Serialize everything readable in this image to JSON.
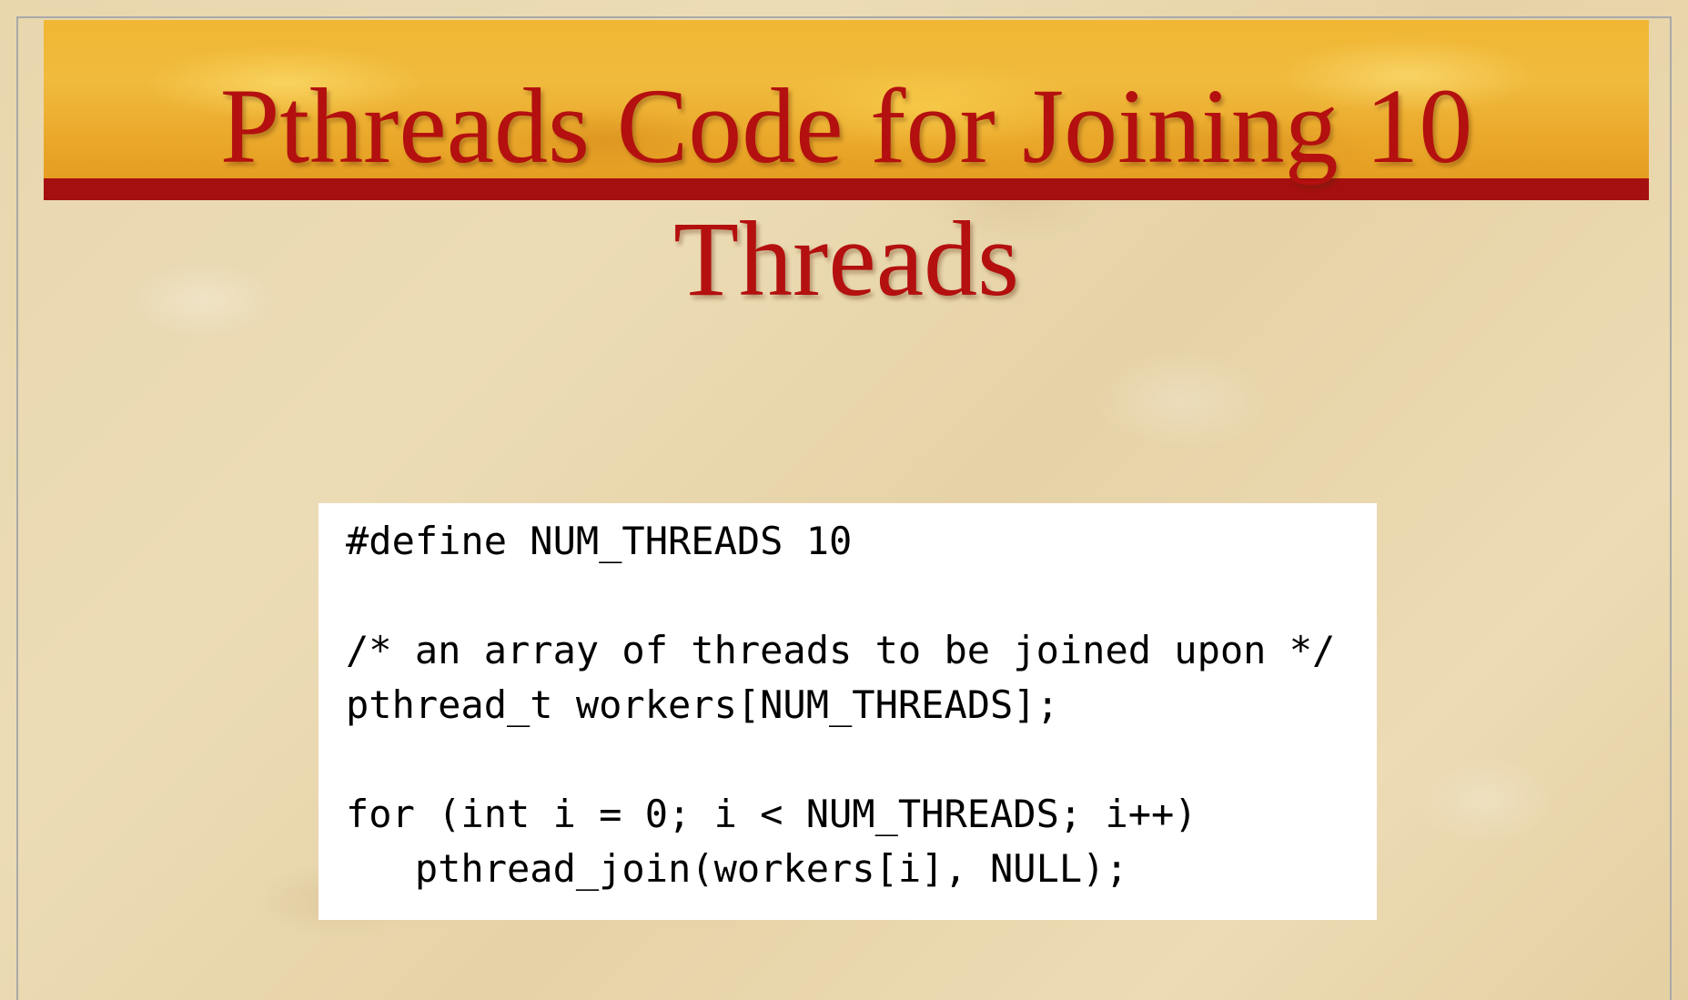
{
  "slide": {
    "title": "Pthreads Code for Joining 10 Threads"
  },
  "code": {
    "lines": [
      "#define NUM_THREADS 10",
      "",
      "/* an array of threads to be joined upon */",
      "pthread_t workers[NUM_THREADS];",
      "",
      "for (int i = 0; i < NUM_THREADS; i++)",
      "   pthread_join(workers[i], NULL);"
    ]
  },
  "colors": {
    "title_text": "#b3100f",
    "title_bar": "#a50f0f",
    "banner": "#f0ba3d"
  }
}
